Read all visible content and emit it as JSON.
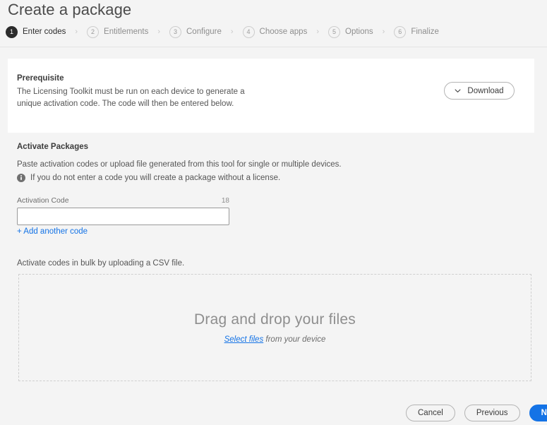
{
  "page": {
    "title": "Create a package"
  },
  "stepper": {
    "separator": "›",
    "steps": [
      {
        "number": "1",
        "label": "Enter codes",
        "state": "active"
      },
      {
        "number": "2",
        "label": "Entitlements",
        "state": "inactive"
      },
      {
        "number": "3",
        "label": "Configure",
        "state": "inactive"
      },
      {
        "number": "4",
        "label": "Choose apps",
        "state": "inactive"
      },
      {
        "number": "5",
        "label": "Options",
        "state": "inactive"
      },
      {
        "number": "6",
        "label": "Finalize",
        "state": "inactive"
      }
    ]
  },
  "prerequisite": {
    "heading": "Prerequisite",
    "body": "The Licensing Toolkit must be run on each device to generate a unique activation code. The code will then be entered below.",
    "download_label": "Download"
  },
  "activate": {
    "heading": "Activate Packages",
    "description": "Paste activation codes or upload file generated from this tool for single or multiple devices.",
    "note": "If you do not enter a code you will create a package without a license.",
    "field_label": "Activation Code",
    "field_counter": "18",
    "field_value": "",
    "field_placeholder": "",
    "add_another_label": "+ Add another code"
  },
  "bulk": {
    "description": "Activate codes in bulk by uploading a CSV file.",
    "dropzone_title": "Drag and drop your files",
    "dropzone_link": "Select files",
    "dropzone_suffix": " from your device"
  },
  "footer": {
    "cancel_label": "Cancel",
    "previous_label": "Previous",
    "next_label": "Next"
  },
  "colors": {
    "accent": "#1473e6",
    "background": "#f4f4f4",
    "card": "#ffffff",
    "active_step": "#2c2c2c",
    "text": "#565656"
  }
}
